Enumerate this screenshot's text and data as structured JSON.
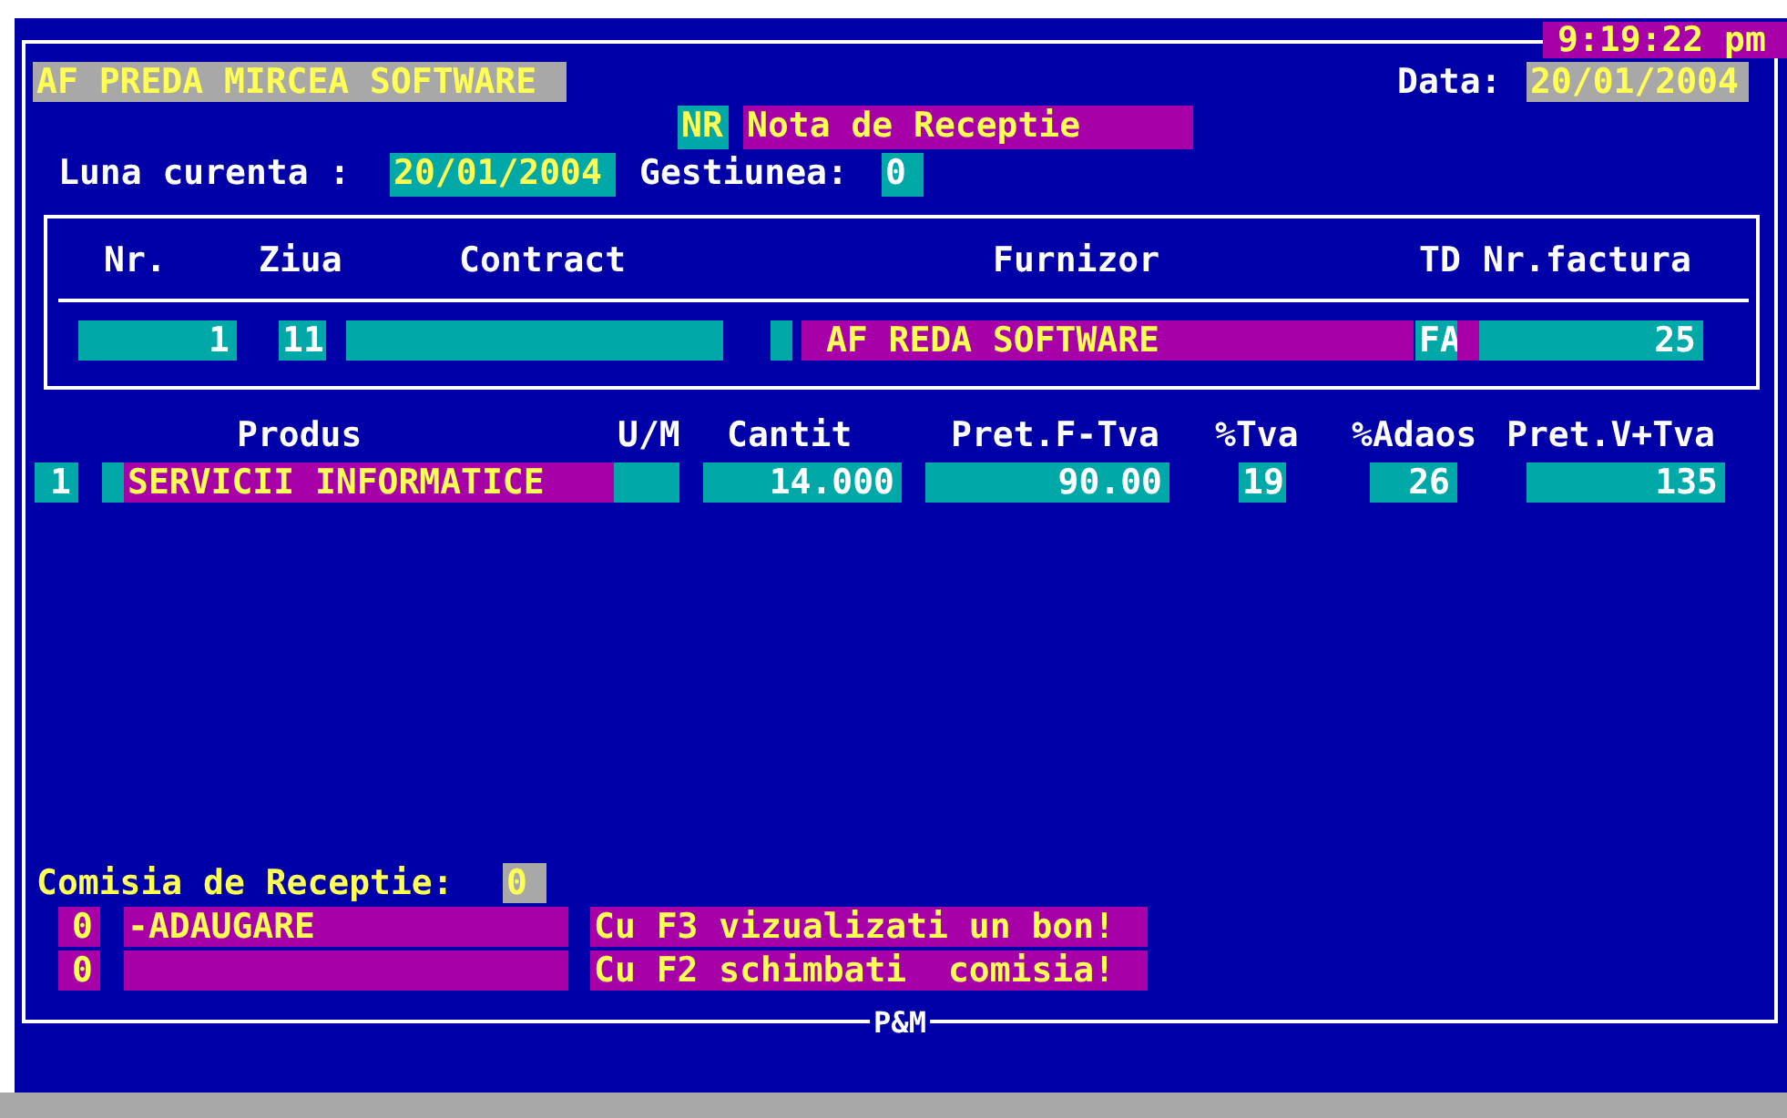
{
  "header": {
    "company": "AF PREDA MIRCEA SOFTWARE",
    "date_label": "Data:",
    "date": "20/01/2004",
    "clock": "9:19:22 pm"
  },
  "document": {
    "nr_label": "NR",
    "title": "Nota de Receptie"
  },
  "period": {
    "label": "Luna curenta :",
    "date": "20/01/2004",
    "gestiune_label": "Gestiunea:",
    "gestiune": "0"
  },
  "invoice": {
    "columns": [
      "Nr.",
      "Ziua",
      "Contract",
      "Furnizor",
      "TD",
      "Nr.factura"
    ],
    "row": {
      "nr": "1",
      "ziua": "11",
      "furnizor": "AF REDA SOFTWARE",
      "td": "FA",
      "nr_factura": "25"
    }
  },
  "products": {
    "columns": [
      "Produs",
      "U/M",
      "Cantit",
      "Pret.F-Tva",
      "%Tva",
      "%Adaos",
      "Pret.V+Tva"
    ],
    "rows": [
      {
        "index": "1",
        "produs": "SERVICII INFORMATICE",
        "cantit": "14.000",
        "pret_f": "90.00",
        "tva": "19",
        "adaos": "26",
        "pret_v": "135"
      }
    ]
  },
  "commission": {
    "label": "Comisia de Receptie:",
    "value": "0",
    "members": [
      {
        "code": "0",
        "name": "-ADAUGARE",
        "hint": "Cu F3 vizualizati un bon!"
      },
      {
        "code": "0",
        "hint": "Cu F2 schimbati  comisia!"
      }
    ]
  },
  "footer": "P&M"
}
